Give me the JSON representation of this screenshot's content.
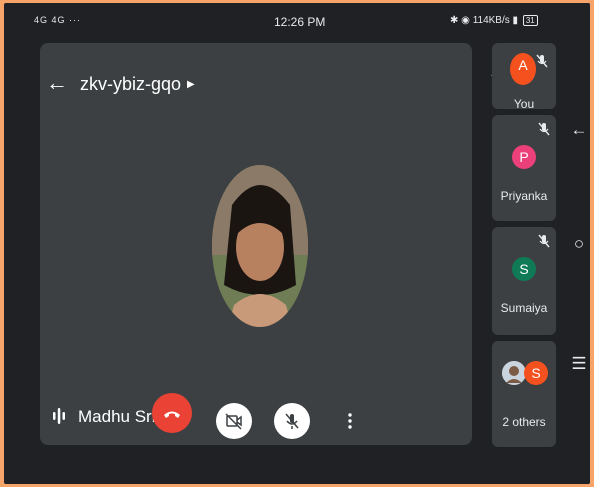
{
  "status_bar": {
    "left_indicators": "4G 4G ···",
    "time": "12:26 PM",
    "network_speed": "114KB/s",
    "battery": "31"
  },
  "header": {
    "meeting_code": "zkv-ybiz-gqo"
  },
  "main_speaker": {
    "name": "Madhu Sriw"
  },
  "participants": [
    {
      "label": "You",
      "avatar_letter": "A",
      "avatar_color": "#f4511e",
      "muted": true
    },
    {
      "label": "Priyanka",
      "avatar_letter": "P",
      "avatar_color": "#ec407a",
      "muted": true
    },
    {
      "label": "Sumaiya",
      "avatar_letter": "S",
      "avatar_color": "#0f7a55",
      "muted": true
    },
    {
      "label": "2 others",
      "avatar_letter": "S",
      "avatar_color": "#f4511e",
      "muted": false
    }
  ],
  "controls": {
    "leave_color": "#ea4335"
  },
  "icons": {
    "back": "back-arrow-icon",
    "switch_camera": "switch-camera-icon",
    "camera_off": "camera-off-icon",
    "mic_off": "mic-off-icon",
    "more": "more-vert-icon",
    "hang_up": "hang-up-icon"
  }
}
